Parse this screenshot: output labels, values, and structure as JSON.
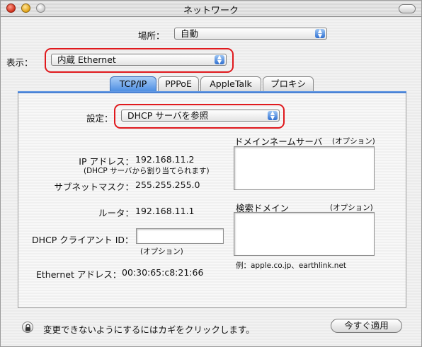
{
  "window": {
    "title": "ネットワーク"
  },
  "location": {
    "label": "場所：",
    "value": "自動"
  },
  "show": {
    "label": "表示：",
    "value": "内蔵 Ethernet"
  },
  "tabs": [
    {
      "label": "TCP/IP",
      "active": true
    },
    {
      "label": "PPPoE",
      "active": false
    },
    {
      "label": "AppleTalk",
      "active": false
    },
    {
      "label": "プロキシ",
      "active": false
    }
  ],
  "configure": {
    "label": "設定：",
    "value": "DHCP サーバを参照"
  },
  "ip": {
    "label": "IP アドレス：",
    "value": "192.168.11.2",
    "note": "(DHCP サーバから割り当てられます)"
  },
  "subnet": {
    "label": "サブネットマスク：",
    "value": "255.255.255.0"
  },
  "router": {
    "label": "ルータ：",
    "value": "192.168.11.1"
  },
  "dhcp_client": {
    "label": "DHCP クライアント ID：",
    "value": "",
    "note": "(オプション)"
  },
  "ethernet": {
    "label": "Ethernet アドレス：",
    "value": "00:30:65:c8:21:66"
  },
  "dns": {
    "label": "ドメインネームサーバ",
    "optional": "(オプション)",
    "value": ""
  },
  "search": {
    "label": "検索ドメイン",
    "optional": "(オプション)",
    "value": "",
    "example": "例：apple.co.jp、earthlink.net"
  },
  "footer": {
    "lock_text": "変更できないようにするにはカギをクリックします。",
    "apply_label": "今すぐ適用"
  },
  "colors": {
    "highlight": "#e0191d",
    "accent": "#4f8fe3"
  }
}
